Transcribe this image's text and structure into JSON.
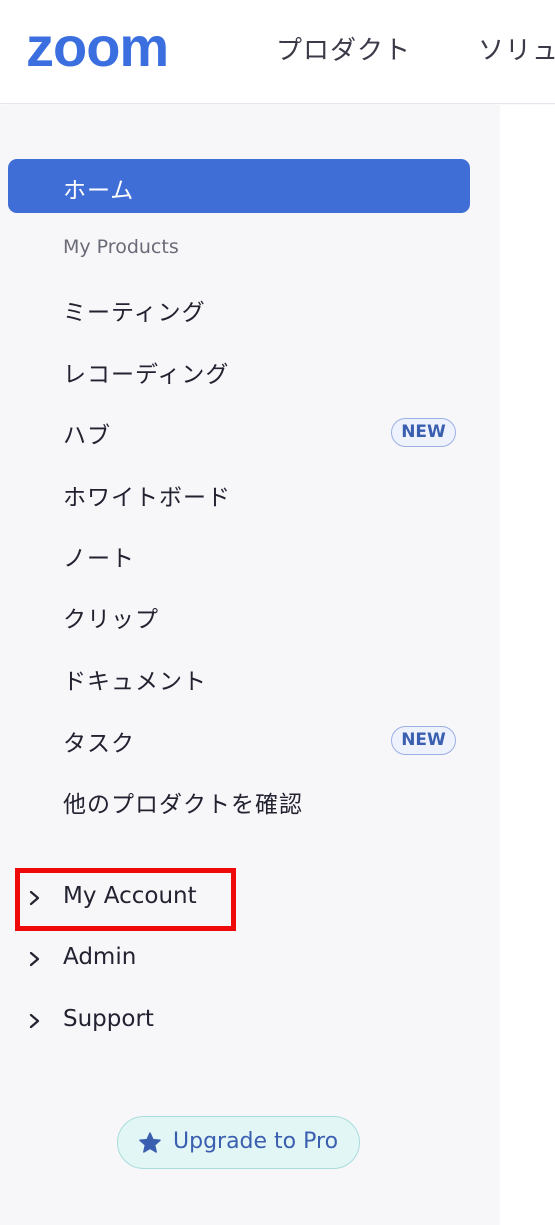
{
  "brand": {
    "logo_text": "zoom",
    "color": "#3b6fe0"
  },
  "header": {
    "nav": [
      "プロダクト",
      "ソリュ"
    ]
  },
  "sidebar": {
    "home_label": "ホーム",
    "section_label": "My Products",
    "items": [
      {
        "label": "ミーティング"
      },
      {
        "label": "レコーディング"
      },
      {
        "label": "ハブ",
        "badge": "NEW"
      },
      {
        "label": "ホワイトボード"
      },
      {
        "label": "ノート"
      },
      {
        "label": "クリップ"
      },
      {
        "label": "ドキュメント"
      },
      {
        "label": "タスク",
        "badge": "NEW"
      },
      {
        "label": "他のプロダクトを確認"
      }
    ],
    "expandables": [
      {
        "label": "My Account",
        "icon": "chevron-right-icon"
      },
      {
        "label": "Admin",
        "icon": "chevron-right-icon"
      },
      {
        "label": "Support",
        "icon": "chevron-right-icon"
      }
    ],
    "upgrade": {
      "label": "Upgrade to Pro",
      "icon": "star-icon"
    }
  },
  "colors": {
    "active_bg": "#3f6fd6",
    "highlight_box": "#ee0a0a",
    "upgrade_bg": "#e2f6f5"
  }
}
